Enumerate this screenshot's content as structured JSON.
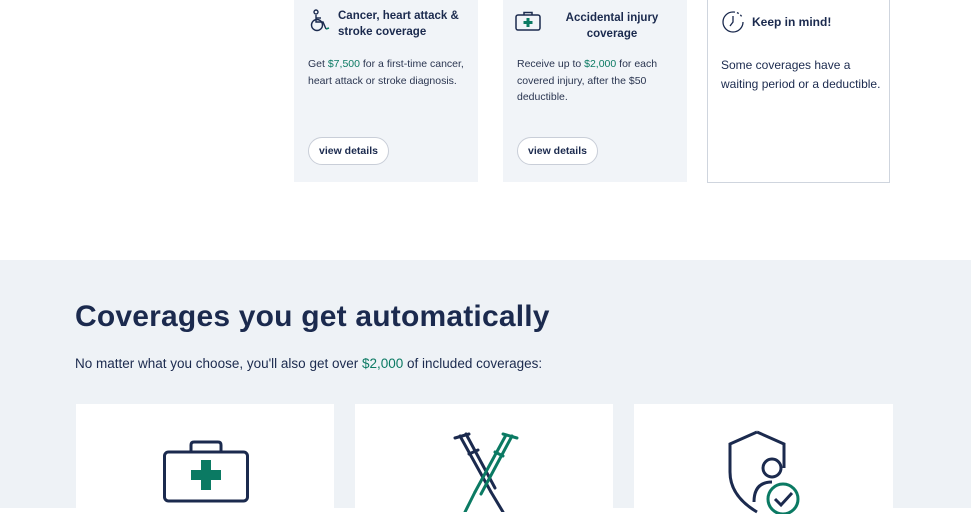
{
  "cards": [
    {
      "icon": "wheelchair-icon",
      "title": "Cancer, heart attack & stroke coverage",
      "desc_prefix": "Get ",
      "desc_amount": "$7,500",
      "desc_suffix": " for a first-time cancer, heart attack or stroke diagnosis.",
      "button": "view details"
    },
    {
      "icon": "first-aid-kit-icon",
      "title": "Accidental injury coverage",
      "desc_prefix": "Receive up to ",
      "desc_amount": "$2,000",
      "desc_suffix": " for each covered injury, after the $50 deductible.",
      "button": "view details"
    }
  ],
  "note": {
    "icon": "timer-icon",
    "title": "Keep in mind!",
    "desc": "Some coverages have a waiting period or a deductible."
  },
  "automatic": {
    "heading": "Coverages you get automatically",
    "sub_prefix": "No matter what you choose, you'll also get over ",
    "sub_amount": "$2,000",
    "sub_suffix": " of included coverages:",
    "cards": [
      {
        "icon": "first-aid-kit-icon"
      },
      {
        "icon": "crutches-icon"
      },
      {
        "icon": "shield-person-check-icon"
      }
    ]
  },
  "colors": {
    "accent": "#0b7a63",
    "navy": "#1b2a4e",
    "card_bg": "#f1f4f8",
    "section_bg": "#eef2f6"
  }
}
